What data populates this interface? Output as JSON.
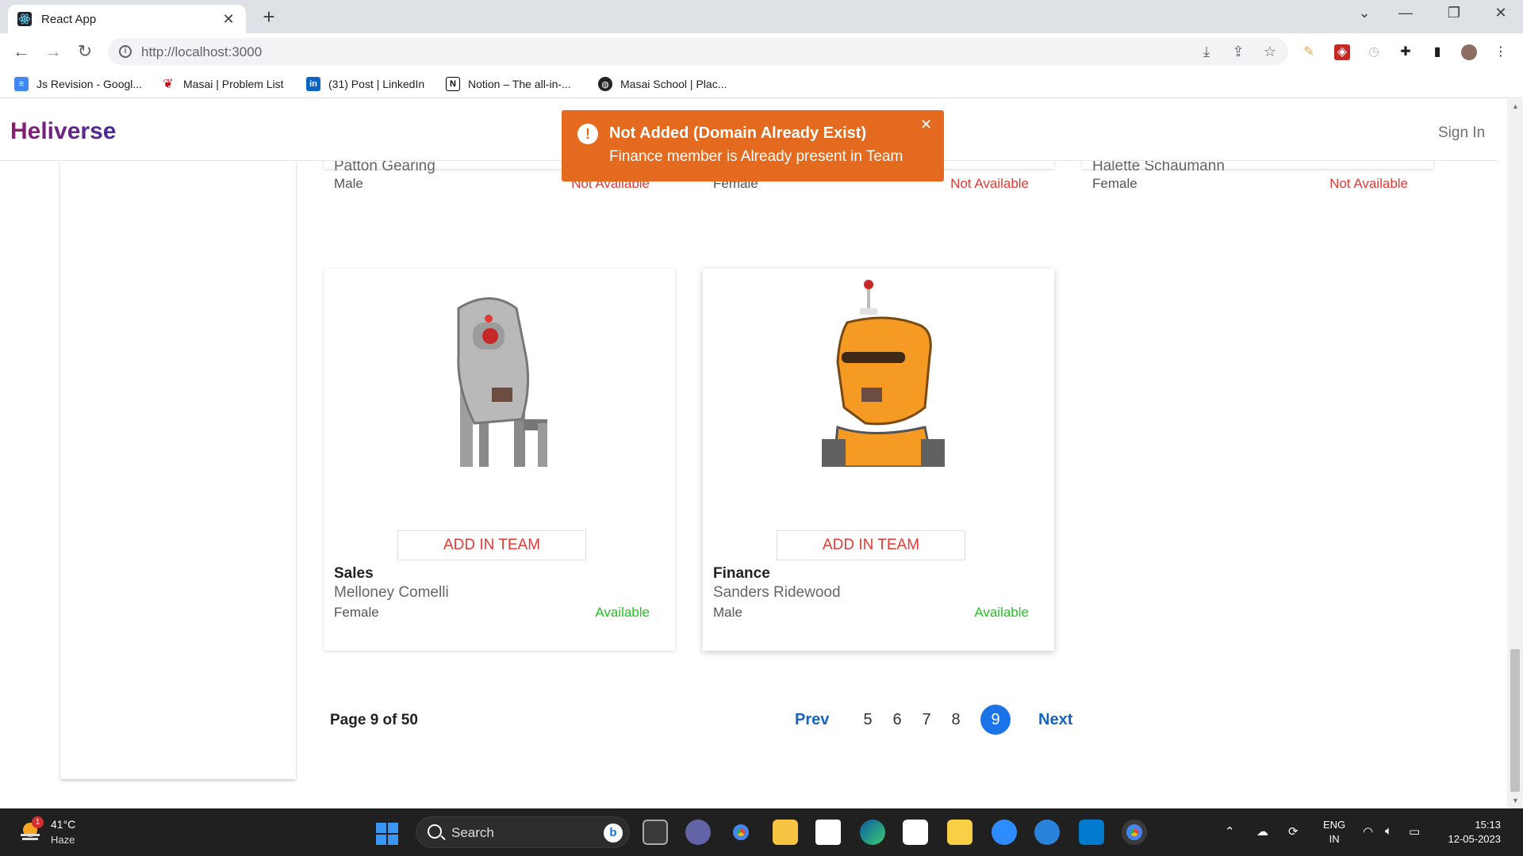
{
  "browser": {
    "tab_title": "React App",
    "url": "http://localhost:3000",
    "bookmarks": [
      {
        "label": "Js Revision - Googl...",
        "icon": "docs-icon"
      },
      {
        "label": "Masai | Problem List",
        "icon": "masai-icon"
      },
      {
        "label": "(31) Post | LinkedIn",
        "icon": "linkedin-icon"
      },
      {
        "label": "Notion – The all-in-...",
        "icon": "notion-icon"
      },
      {
        "label": "Masai School | Plac...",
        "icon": "globe-icon"
      }
    ]
  },
  "app": {
    "brand": "Heliverse",
    "sign_in": "Sign In"
  },
  "toast": {
    "title": "Not Added (Domain Already Exist)",
    "message": "Finance member is Already present in Team",
    "color": "#e36a1e"
  },
  "top_cards": [
    {
      "name": "Patton Gearing",
      "gender": "Male",
      "status": "Not Available"
    },
    {
      "name": "",
      "gender": "Female",
      "status": "Not Available"
    },
    {
      "name": "Halette Schaumann",
      "gender": "Female",
      "status": "Not Available"
    }
  ],
  "cards": [
    {
      "button": "ADD IN TEAM",
      "domain": "Sales",
      "name": "Melloney Comelli",
      "gender": "Female",
      "status": "Available"
    },
    {
      "button": "ADD IN TEAM",
      "domain": "Finance",
      "name": "Sanders Ridewood",
      "gender": "Male",
      "status": "Available"
    }
  ],
  "pagination": {
    "info": "Page 9 of 50",
    "prev": "Prev",
    "next": "Next",
    "pages": [
      "5",
      "6",
      "7",
      "8"
    ],
    "current": "9"
  },
  "taskbar": {
    "temperature": "41°C",
    "weather": "Haze",
    "notification_count": "1",
    "search": "Search",
    "lang_top": "ENG",
    "lang_bottom": "IN",
    "time": "15:13",
    "date": "12-05-2023"
  }
}
